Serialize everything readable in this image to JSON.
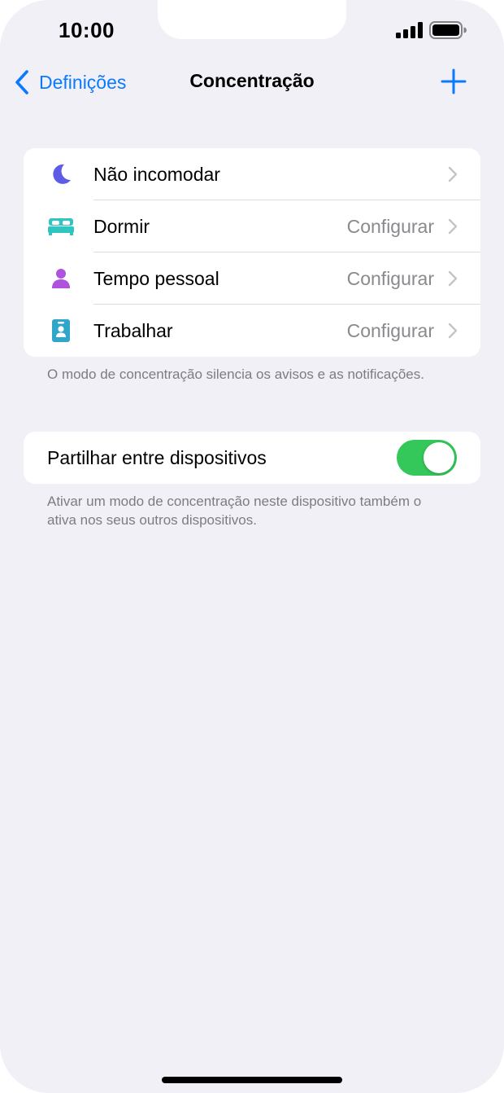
{
  "status_bar": {
    "time": "10:00"
  },
  "nav": {
    "back_label": "Definições",
    "title": "Concentração"
  },
  "focus_modes": [
    {
      "label": "Não incomodar",
      "value": "",
      "icon": "moon-icon",
      "color": "#5e5ce6"
    },
    {
      "label": "Dormir",
      "value": "Configurar",
      "icon": "bed-icon",
      "color": "#30c5c0"
    },
    {
      "label": "Tempo pessoal",
      "value": "Configurar",
      "icon": "person-icon",
      "color": "#af52de"
    },
    {
      "label": "Trabalhar",
      "value": "Configurar",
      "icon": "id-badge-icon",
      "color": "#30a6c8"
    }
  ],
  "focus_footnote": "O modo de concentração silencia os avisos e as notificações.",
  "share": {
    "label": "Partilhar entre dispositivos",
    "enabled": true,
    "footnote": "Ativar um modo de concentração neste dispositivo também o ativa nos seus outros dispositivos."
  },
  "colors": {
    "accent": "#0a7aff",
    "toggle_on": "#34c759",
    "background": "#f1f0f6"
  }
}
